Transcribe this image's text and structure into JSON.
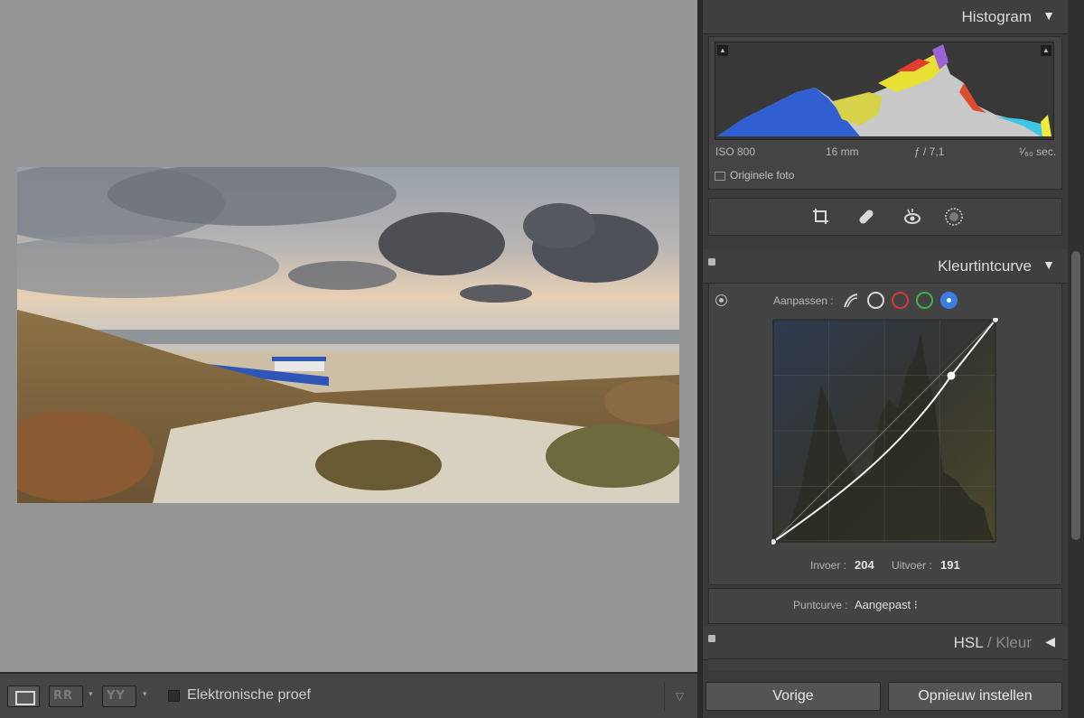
{
  "toolbar": {
    "view_lr_glyph": "RR",
    "view_tb_glyph": "YY",
    "proof_label": "Elektronische proef",
    "menu_glyph": "▽"
  },
  "histogram": {
    "title": "Histogram",
    "arrow": "▼",
    "iso": "ISO 800",
    "focal": "16 mm",
    "aperture": "ƒ / 7,1",
    "shutter": "¹⁄₆₀ sec.",
    "original_photo_label": "Originele foto",
    "clip_glyph": "▲"
  },
  "tools": [
    "crop-icon",
    "healing-icon",
    "redeye-icon",
    "mask-icon"
  ],
  "tone_curve": {
    "title": "Kleurtintcurve",
    "arrow": "▼",
    "adjust_label": "Aanpassen :",
    "channels": [
      {
        "name": "rgb",
        "color": "#d8d8d8"
      },
      {
        "name": "red",
        "color": "#d23b3b"
      },
      {
        "name": "green",
        "color": "#3fb24a"
      },
      {
        "name": "blue",
        "color": "#3b7de0"
      }
    ],
    "input_label": "Invoer :",
    "input_value": "204",
    "output_label": "Uitvoer :",
    "output_value": "191",
    "point_curve_label": "Puntcurve :",
    "point_curve_value": "Aangepast ⁝"
  },
  "hsl": {
    "title_a": "HSL",
    "slash": "/",
    "title_b": "Kleur",
    "arrow": "◀"
  },
  "buttons": {
    "previous": "Vorige",
    "reset": "Opnieuw instellen"
  }
}
